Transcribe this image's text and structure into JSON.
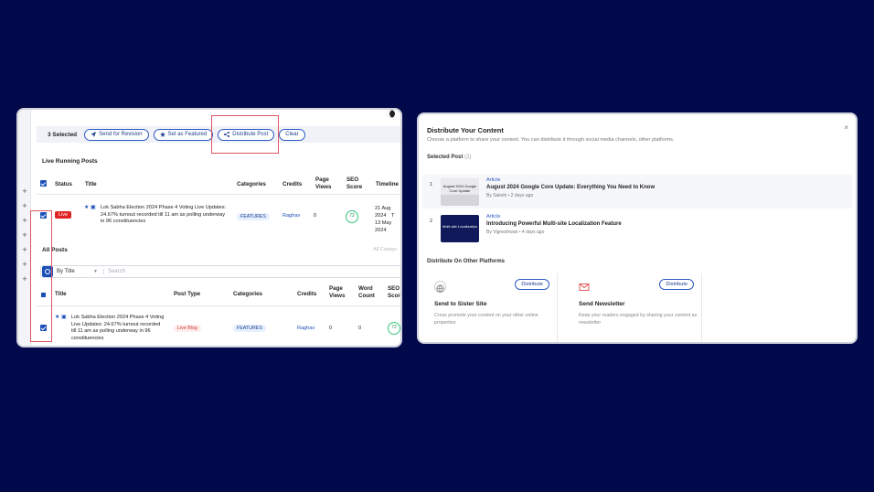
{
  "left": {
    "toolbar": {
      "selected": "3 Selected",
      "send_revision": "Send for Revision",
      "set_featured": "Set as Featured",
      "distribute": "Distribute Post",
      "clear": "Clear"
    },
    "live_running": {
      "title": "Live Running Posts",
      "headers": {
        "status": "Status",
        "title": "Title",
        "categories": "Categories",
        "credits": "Credits",
        "page_views": "Page Views",
        "seo_score": "SEO Score",
        "timeline": "Timeline"
      },
      "row": {
        "status": "Live",
        "title": "Lok Sabha Election 2024 Phase 4 Voting Live Updates: 24.67% turnout recorded till 11 am as polling underway in 96 constituencies",
        "category": "FEATURES",
        "credit": "Raghav",
        "views": "0",
        "seo": "72",
        "timeline_start": "21 Aug 2024",
        "timeline_sep": "T",
        "timeline_end": "13 May 2024"
      }
    },
    "all_posts": {
      "title": "All Posts",
      "category_ph": "All Catego",
      "by_title": "By Title",
      "search_ph": "Search",
      "headers": {
        "title": "Title",
        "post_type": "Post Type",
        "categories": "Categories",
        "credits": "Credits",
        "page_views": "Page Views",
        "word_count": "Word Count",
        "seo_score": "SEO Score"
      },
      "row": {
        "title": "Lok Sabha Election 2024 Phase 4 Voting Live Updates: 24.67% turnout recorded till 11 am as polling underway in 96 constituencies",
        "post_type": "Live Blog",
        "category": "FEATURES",
        "credit": "Raghav",
        "views": "0",
        "words": "0",
        "seo": "72"
      }
    }
  },
  "right": {
    "title": "Distribute Your Content",
    "subtitle": "Choose a platform to share your content. You can distribute it through social media channels, other platforms.",
    "close": "×",
    "selected_label": "Selected Post",
    "selected_count": "(2)",
    "posts": [
      {
        "num": "1",
        "type": "Article",
        "title": "August 2024 Google Core Update: Everything You Need to Know",
        "meta": "By Sakshi •   2 days ago",
        "thumb_text": "August 2024 Google Core Update"
      },
      {
        "num": "2",
        "type": "Article",
        "title": "Introducing Powerful Multi-site Localization Feature",
        "meta": "By Vigneshwari •   4 days ago",
        "thumb_text": "Multi-site Localization"
      }
    ],
    "platforms_label": "Distribute On Other Platforms",
    "platforms": [
      {
        "title": "Send to Sister Site",
        "desc": "Cross promote your content on your other online properties",
        "button": "Distribute"
      },
      {
        "title": "Send Newsletter",
        "desc": "Keep your readers engaged by sharing your content as newsletter",
        "button": "Distribute"
      }
    ]
  },
  "colors": {
    "background": "#02094a",
    "accent": "#1a4fb8",
    "highlight": "#e05563",
    "live": "#e02424"
  }
}
